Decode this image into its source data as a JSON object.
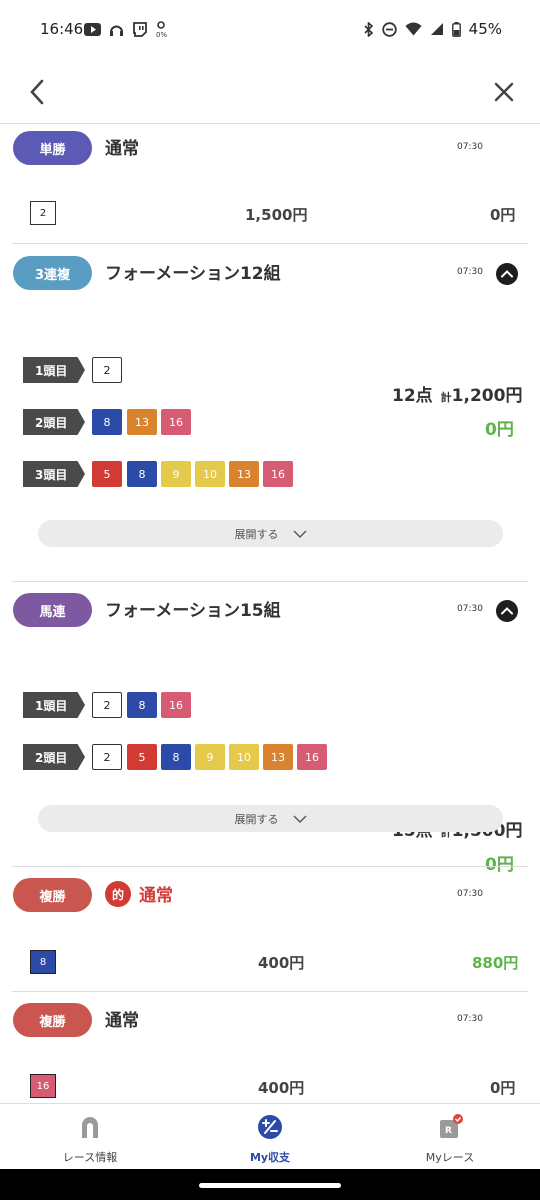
{
  "status": {
    "time": "16:46",
    "battery": "45%"
  },
  "colors": {
    "win": "#5b5bb5",
    "trio": "#5a9dc3",
    "quinella": "#7e58a0",
    "place": "#c9574f",
    "green": "#5db44a"
  },
  "bets": [
    {
      "type": "単勝",
      "title": "通常",
      "time": "07:30",
      "numbers": [
        "2"
      ],
      "stake": "1,500円",
      "payout": "0円"
    },
    {
      "type": "3連複",
      "title": "フォーメーション12組",
      "time": "07:30",
      "rows": [
        {
          "label": "1頭目",
          "numbers": [
            "2"
          ]
        },
        {
          "label": "2頭目",
          "numbers": [
            "8",
            "13",
            "16"
          ]
        },
        {
          "label": "3頭目",
          "numbers": [
            "5",
            "8",
            "9",
            "10",
            "13",
            "16"
          ]
        }
      ],
      "points": "12点",
      "total_prefix": "計",
      "total": "1,200円",
      "payout": "0円",
      "expand_label": "展開する"
    },
    {
      "type": "馬連",
      "title": "フォーメーション15組",
      "time": "07:30",
      "rows": [
        {
          "label": "1頭目",
          "numbers": [
            "2",
            "8",
            "16"
          ]
        },
        {
          "label": "2頭目",
          "numbers": [
            "2",
            "5",
            "8",
            "9",
            "10",
            "13",
            "16"
          ]
        }
      ],
      "points": "15点",
      "total_prefix": "計",
      "total": "1,500円",
      "payout": "0円",
      "expand_label": "展開する"
    },
    {
      "type": "複勝",
      "hit_badge": "的",
      "title": "通常",
      "time": "07:30",
      "numbers": [
        "8"
      ],
      "stake": "400円",
      "payout": "880円"
    },
    {
      "type": "複勝",
      "title": "通常",
      "time": "07:30",
      "numbers": [
        "16"
      ],
      "stake": "400円",
      "payout": "0円"
    }
  ],
  "bottom_nav": [
    {
      "label": "レース情報",
      "icon": "horseshoe-icon"
    },
    {
      "label": "My収支",
      "icon": "plus-minus-icon"
    },
    {
      "label": "Myレース",
      "icon": "race-card-icon"
    }
  ]
}
